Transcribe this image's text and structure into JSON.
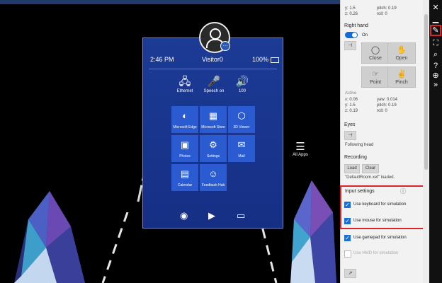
{
  "hologram": {
    "status": {
      "time": "2:46 PM",
      "user": "Visitor0",
      "battery": "100%"
    },
    "avatar_badge": "…",
    "quick_actions": [
      {
        "icon": "ethernet-icon",
        "glyph": "🖧",
        "label": "Ethernet"
      },
      {
        "icon": "microphone-icon",
        "glyph": "🎤",
        "label": "Speech on"
      },
      {
        "icon": "speaker-icon",
        "glyph": "🔊",
        "label": "100"
      }
    ],
    "tiles": [
      {
        "icon": "edge-icon",
        "glyph": "◐",
        "label": "Microsoft Edge"
      },
      {
        "icon": "store-icon",
        "glyph": "▦",
        "label": "Microsoft Store"
      },
      {
        "icon": "cube-icon",
        "glyph": "⬡",
        "label": "3D Viewer"
      },
      {
        "icon": "photos-icon",
        "glyph": "▣",
        "label": "Photos"
      },
      {
        "icon": "settings-icon",
        "glyph": "⚙",
        "label": "Settings"
      },
      {
        "icon": "mail-icon",
        "glyph": "✉",
        "label": "Mail"
      },
      {
        "icon": "calendar-icon",
        "glyph": "▤",
        "label": "Calendar"
      },
      {
        "icon": "feedback-icon",
        "glyph": "☺",
        "label": "Feedback Hub"
      }
    ],
    "bottom": [
      {
        "icon": "camera-icon",
        "glyph": "◉"
      },
      {
        "icon": "video-icon",
        "glyph": "▶"
      },
      {
        "icon": "cast-icon",
        "glyph": "▭"
      }
    ],
    "all_apps": {
      "label": "All Apps",
      "glyph": "☰"
    }
  },
  "panel": {
    "top_readout": {
      "y": "y: 1.5",
      "z": "z: 0.26",
      "pitch": "pitch: 0.19",
      "roll": "roll: 0"
    },
    "right_hand": {
      "title": "Right hand",
      "toggle_label": "On",
      "pin_glyph": "⊣",
      "gestures": [
        {
          "icon": "close-gesture-icon",
          "glyph": "◯",
          "label": "Close"
        },
        {
          "icon": "open-hand-icon",
          "glyph": "✋",
          "label": "Open"
        },
        {
          "icon": "point-gesture-icon",
          "glyph": "☞",
          "label": "Point"
        },
        {
          "icon": "pinch-gesture-icon",
          "glyph": "✌",
          "label": "Pinch"
        }
      ],
      "active_label": "Active",
      "readout": {
        "x": "x: 0.06",
        "y": "y: 1.5",
        "z": "z: 0.19",
        "yaw": "yaw: 0.014",
        "pitch": "pitch: 0.19",
        "roll": "roll: 0"
      }
    },
    "eyes": {
      "title": "Eyes",
      "pin_glyph": "⊣",
      "status": "Following head"
    },
    "recording": {
      "title": "Recording",
      "load": "Load",
      "clear": "Clear",
      "status": "\"DefaultRoom.xef\" loaded."
    },
    "input_settings": {
      "title": "Input settings",
      "info_glyph": "ⓘ",
      "options": [
        {
          "label": "Use keyboard for simulation",
          "checked": true
        },
        {
          "label": "Use mouse for simulation",
          "checked": true
        },
        {
          "label": "Use gamepad for simulation",
          "checked": true
        },
        {
          "label": "Use HMD for simulation",
          "checked": false
        }
      ]
    },
    "bottom_glyph": "↗"
  },
  "sidebar_buttons": [
    {
      "icon": "close-icon",
      "glyph": "✕"
    },
    {
      "icon": "minimize-icon",
      "glyph": "▁"
    },
    {
      "icon": "tools-panel-icon",
      "glyph": "✎"
    },
    {
      "icon": "fit-screen-icon",
      "glyph": "⛶"
    },
    {
      "icon": "zoom-icon",
      "glyph": "⌕"
    },
    {
      "icon": "help-icon",
      "glyph": "?"
    },
    {
      "icon": "globe-icon",
      "glyph": "⊕"
    },
    {
      "icon": "expand-icon",
      "glyph": "»"
    }
  ],
  "colors": {
    "accent": "#1a6fd6",
    "highlight": "#d8262b",
    "tile": "#2a5bd0"
  }
}
